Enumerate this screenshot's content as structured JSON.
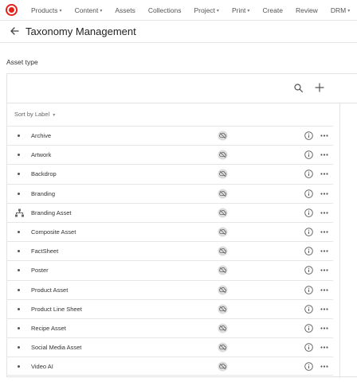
{
  "nav": {
    "items": [
      {
        "label": "Products",
        "dropdown": true
      },
      {
        "label": "Content",
        "dropdown": true
      },
      {
        "label": "Assets",
        "dropdown": false
      },
      {
        "label": "Collections",
        "dropdown": false
      },
      {
        "label": "Project",
        "dropdown": true
      },
      {
        "label": "Print",
        "dropdown": true
      },
      {
        "label": "Create",
        "dropdown": false
      },
      {
        "label": "Review",
        "dropdown": false
      },
      {
        "label": "DRM",
        "dropdown": true
      }
    ],
    "caret": "▾",
    "logo_color": "#e2231a"
  },
  "header": {
    "title": "Taxonomy Management",
    "back_icon": "arrow-left-icon"
  },
  "section": {
    "label": "Asset type"
  },
  "toolbar": {
    "search_icon": "search-icon",
    "add_icon": "plus-icon"
  },
  "sort": {
    "label": "Sort by Label",
    "caret": "▾"
  },
  "rows": [
    {
      "label": "Archive",
      "icon": "bullet"
    },
    {
      "label": "Artwork",
      "icon": "bullet"
    },
    {
      "label": "Backdrop",
      "icon": "bullet"
    },
    {
      "label": "Branding",
      "icon": "bullet"
    },
    {
      "label": "Branding Asset",
      "icon": "hierarchy-icon"
    },
    {
      "label": "Composite Asset",
      "icon": "bullet"
    },
    {
      "label": "FactSheet",
      "icon": "bullet"
    },
    {
      "label": "Poster",
      "icon": "bullet"
    },
    {
      "label": "Product Asset",
      "icon": "bullet"
    },
    {
      "label": "Product Line Sheet",
      "icon": "bullet"
    },
    {
      "label": "Recipe Asset",
      "icon": "bullet"
    },
    {
      "label": "Social Media Asset",
      "icon": "bullet"
    },
    {
      "label": "Video AI",
      "icon": "bullet"
    }
  ]
}
